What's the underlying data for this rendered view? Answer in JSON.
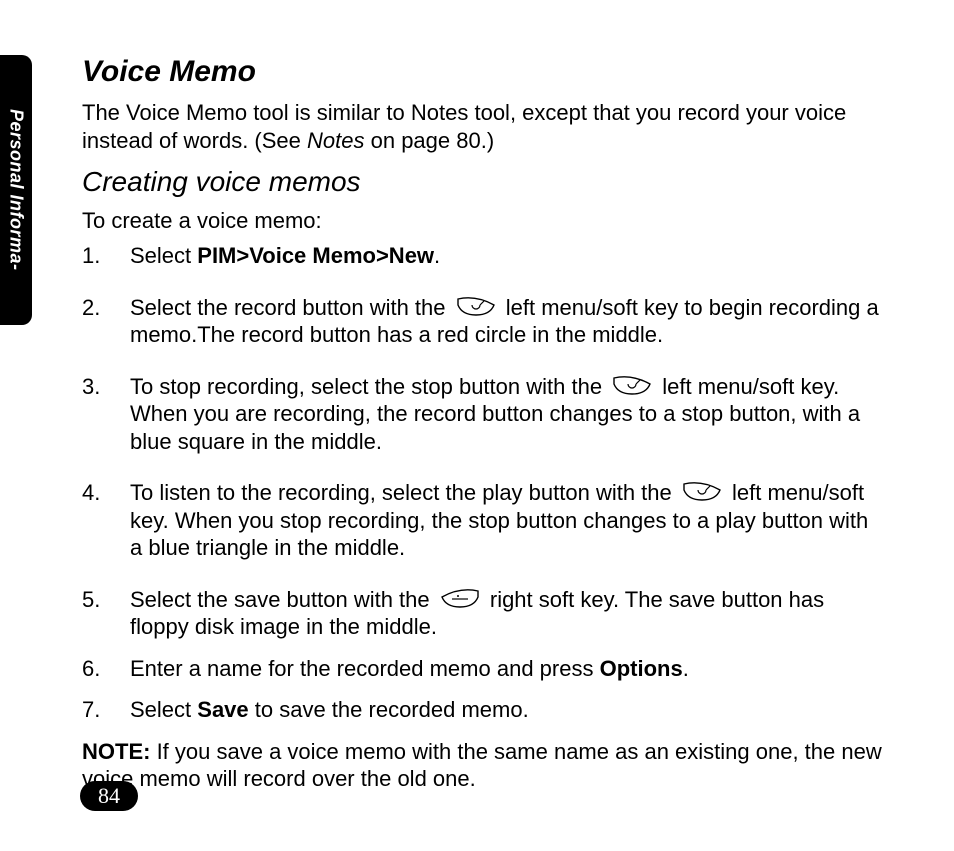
{
  "sidebar": {
    "label": "Personal Informa-"
  },
  "title": "Voice Memo",
  "intro": {
    "part1": "The Voice Memo tool is similar to Notes tool, except that you record your voice instead of words. (See ",
    "notes_word": "Notes",
    "part2": " on page 80.)"
  },
  "subhead": "Creating voice memos",
  "lead": "To create a voice memo:",
  "steps": {
    "s1": {
      "num": "1.",
      "pre": "Select ",
      "path": "PIM>Voice Memo>New",
      "post": "."
    },
    "s2": {
      "num": "2.",
      "pre": "Select the record button with the ",
      "post": " left menu/soft key to begin recording a memo.The record button has a red circle in the middle."
    },
    "s3": {
      "num": "3.",
      "pre": "To stop recording, select the stop button with the ",
      "post": " left menu/soft key. When you are recording, the record button changes to a stop button, with a blue square in the middle."
    },
    "s4": {
      "num": "4.",
      "pre": " To listen to the recording, select the play button with the ",
      "post": " left menu/soft key. When you stop recording, the stop button changes to a play button with a blue triangle in the middle."
    },
    "s5": {
      "num": "5.",
      "pre": "Select the save button with the ",
      "post": " right soft key. The save button has floppy disk image in the middle."
    },
    "s6": {
      "num": "6.",
      "pre": "Enter a name for the recorded memo and press ",
      "bold": "Options",
      "post": "."
    },
    "s7": {
      "num": "7.",
      "pre": "Select ",
      "bold": "Save",
      "post": " to save the recorded memo."
    }
  },
  "note": {
    "label": "NOTE:",
    "text": " If you save a voice memo with the same name as an existing one, the new voice memo will record over the old one."
  },
  "page_number": "84"
}
